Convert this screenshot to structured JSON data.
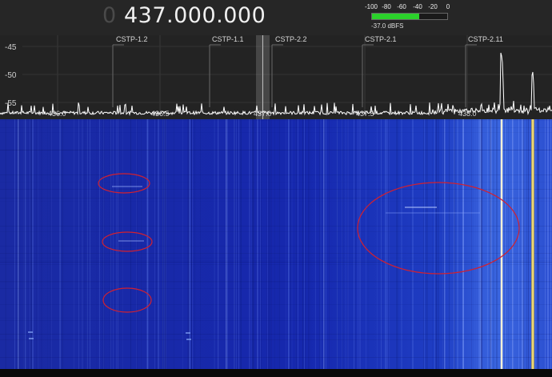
{
  "frequency": {
    "leading": "0",
    "value": "437.000.000"
  },
  "signal_meter": {
    "scale": [
      "-100",
      "-80",
      "-60",
      "-40",
      "-20",
      "0"
    ],
    "reading": "-37.0 dBFS",
    "level_dbfs": -37.0,
    "fill_color": "#2bd12b"
  },
  "spectrum": {
    "y_ticks": [
      "-45",
      "-50",
      "-55"
    ],
    "x_ticks": [
      "436.0",
      "436.5",
      "437.0",
      "437.5",
      "438.0"
    ],
    "markers": [
      "CSTP-1.2",
      "CSTP-1.1",
      "CSTP-2.2",
      "CSTP-2.1",
      "CSTP-2.11"
    ],
    "trace_color": "#ffffff"
  },
  "waterfall": {
    "base_color": "#1526a8",
    "annotation_color": "#d22030"
  }
}
